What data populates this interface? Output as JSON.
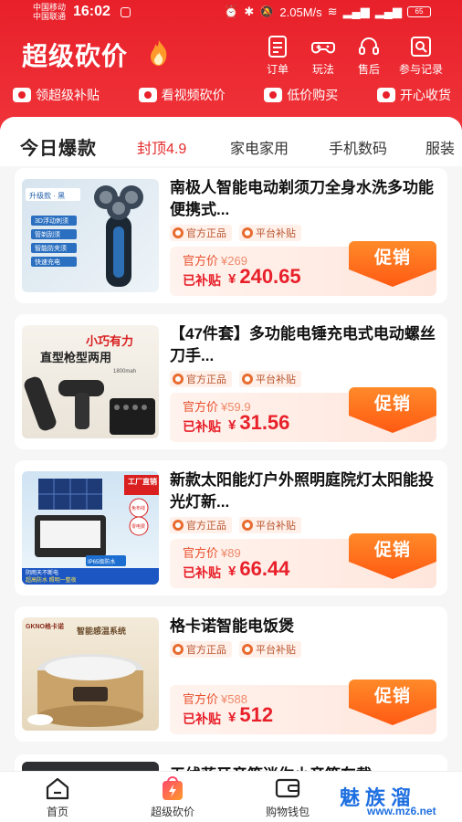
{
  "status_bar": {
    "carrier_1": "中国移动",
    "carrier_2": "中国联通",
    "time": "16:02",
    "net_speed": "2.05M/s",
    "battery": "65"
  },
  "header": {
    "title": "超级砍价",
    "actions": [
      {
        "label": "订单",
        "icon": "order-icon"
      },
      {
        "label": "玩法",
        "icon": "gamepad-icon"
      },
      {
        "label": "售后",
        "icon": "headset-icon"
      },
      {
        "label": "参与记录",
        "icon": "record-icon"
      }
    ],
    "features": [
      {
        "label": "领超级补贴",
        "icon": "coin-icon"
      },
      {
        "label": "看视频砍价",
        "icon": "video-icon"
      },
      {
        "label": "低价购买",
        "icon": "bag-icon"
      },
      {
        "label": "开心收货",
        "icon": "card-icon"
      }
    ]
  },
  "tabs": {
    "today": "今日爆款",
    "items": [
      "封顶4.9",
      "家电家用",
      "手机数码",
      "服装"
    ]
  },
  "products": [
    {
      "title": "南极人智能电动剃须刀全身水洗多功能便携式...",
      "badge_official": "官方正品",
      "badge_subsidy": "平台补贴",
      "orig_label": "官方价",
      "orig_price": "¥269",
      "sub_label": "已补贴",
      "yen": "¥",
      "price": "240.65",
      "cta": "促销"
    },
    {
      "title": "【47件套】多功能电锤充电式电动螺丝刀手...",
      "badge_official": "官方正品",
      "badge_subsidy": "平台补贴",
      "orig_label": "官方价",
      "orig_price": "¥59.9",
      "sub_label": "已补贴",
      "yen": "¥",
      "price": "31.56",
      "cta": "促销"
    },
    {
      "title": "新款太阳能灯户外照明庭院灯太阳能投光灯新...",
      "badge_official": "官方正品",
      "badge_subsidy": "平台补贴",
      "orig_label": "官方价",
      "orig_price": "¥89",
      "sub_label": "已补贴",
      "yen": "¥",
      "price": "66.44",
      "cta": "促销"
    },
    {
      "title": "格卡诺智能电饭煲",
      "badge_official": "官方正品",
      "badge_subsidy": "平台补贴",
      "orig_label": "官方价",
      "orig_price": "¥588",
      "sub_label": "已补贴",
      "yen": "¥",
      "price": "512",
      "cta": "促销"
    }
  ],
  "product_images": [
    {
      "tag": "升级款 · 黑",
      "lines": [
        "3D浮动刺须",
        "管剃刮须",
        "智能防夹须",
        "快速充电"
      ]
    },
    {
      "tag": "小巧有力",
      "headline": "直型枪型两用",
      "sub": "1800mah"
    },
    {
      "tag": "工厂直销",
      "stickers": [
        "免布线",
        "零电费"
      ],
      "chip": "IP65级防水",
      "footer": [
        "阴雨天不断电",
        "超高防水 照明一整夜"
      ]
    },
    {
      "brand": "GKNO格卡诺",
      "tag": "智能感温系统"
    }
  ],
  "partial_product": {
    "title": "无线蓝牙音箱迷你小音箱车载"
  },
  "bottom_nav": [
    {
      "label": "首页",
      "icon": "home-icon"
    },
    {
      "label": "超级砍价",
      "icon": "lightning-bag-icon"
    },
    {
      "label": "购物钱包",
      "icon": "wallet-icon"
    }
  ],
  "watermark": {
    "text": "魅族溜",
    "url": "www.mz6.net"
  },
  "colors": {
    "brand_red": "#e8202a",
    "promo_orange": "#ff6a1a",
    "price_red": "#e8202a"
  }
}
